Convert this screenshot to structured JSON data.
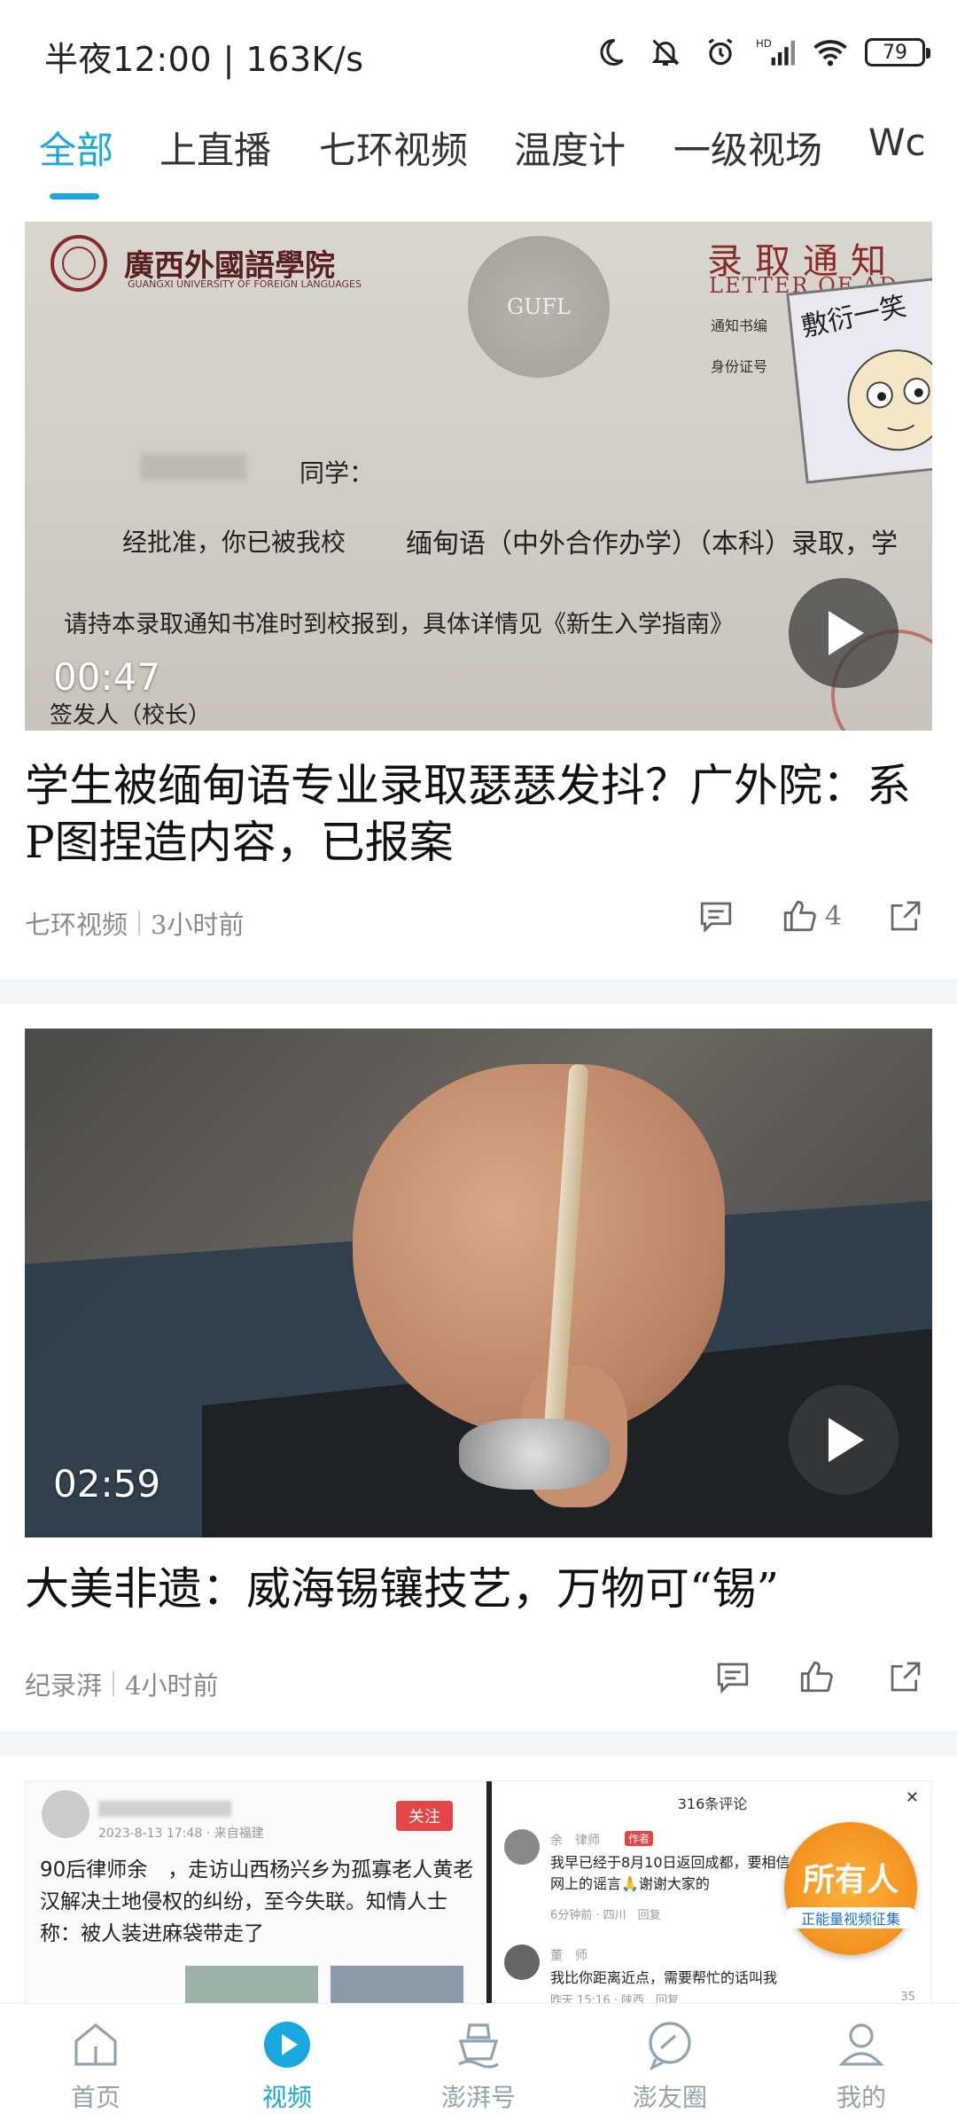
{
  "status": {
    "time_speed": "半夜12:00 | 163K/s",
    "battery": "79",
    "icons": [
      "moon-icon",
      "mute-bell-icon",
      "alarm-icon",
      "hd-signal-icon",
      "wifi-icon",
      "battery-icon"
    ]
  },
  "tabs": [
    {
      "label": "全部",
      "active": true
    },
    {
      "label": "上直播"
    },
    {
      "label": "七环视频"
    },
    {
      "label": "温度计"
    },
    {
      "label": "一级视场"
    },
    {
      "label": "Wc"
    }
  ],
  "feed": [
    {
      "duration": "00:47",
      "title": "学生被缅甸语专业录取瑟瑟发抖？广外院：系P图捏造内容，已报案",
      "source": "七环视频",
      "time": "3小时前",
      "likes": "4",
      "thumb_text": {
        "school": "廣西外國語學院",
        "school_en": "GUANGXI UNIVERSITY OF FOREIGN LANGUAGES",
        "letter": "录取通知",
        "letter_en": "LETTER OF AD",
        "seal": "GUFL",
        "sticker": "敷衍一笑",
        "line1": "同学：",
        "line2a": "经批准，你已被我校",
        "line2b": "缅甸语（中外合作办学）（本科）录取，学",
        "line3": "请持本录取通知书准时到校报到，具体详情见《新生入学指南》",
        "line4": "签发人（校长）",
        "small1": "通知书编",
        "small2": "身份证号"
      }
    },
    {
      "duration": "02:59",
      "title": "大美非遗：威海锡镶技艺，万物可“锡”",
      "source": "纪录湃",
      "time": "4小时前",
      "likes": ""
    },
    {
      "thumb_text": {
        "follow": "关注",
        "date": "2023-8-13 17:48 · 来自福建",
        "body": "90后律师余　，走访山西杨兴乡为孤寡老人黄老汉解决土地侵权的纠纷，至今失联。知情人士称：被人装进麻袋带走了",
        "comments": "316条评论",
        "c1_name": "余　律师",
        "c1_tag": "作者",
        "c1_text": "我早已经于8月10日返回成都，要相信网上的谣言🙏谢谢大家的",
        "c1_meta": "6分钟前 · 四川　回复",
        "c2_name": "董　师",
        "c2_text": "我比你距离近点，需要帮忙的话叫我",
        "c2_meta": "昨天 15:16 · 陕西　回复",
        "c2_likes": "35",
        "badge_title": "所有人",
        "badge_sub": "正能量视频征集"
      }
    }
  ],
  "bottom_nav": [
    {
      "label": "首页",
      "icon": "home-icon"
    },
    {
      "label": "视频",
      "icon": "video-icon",
      "active": true
    },
    {
      "label": "澎湃号",
      "icon": "ship-icon"
    },
    {
      "label": "澎友圈",
      "icon": "chat-icon"
    },
    {
      "label": "我的",
      "icon": "profile-icon"
    }
  ],
  "colors": {
    "accent": "#1aa7e0",
    "nav_inactive": "#8fa3b3",
    "meta_gray": "#8a8a8a"
  }
}
